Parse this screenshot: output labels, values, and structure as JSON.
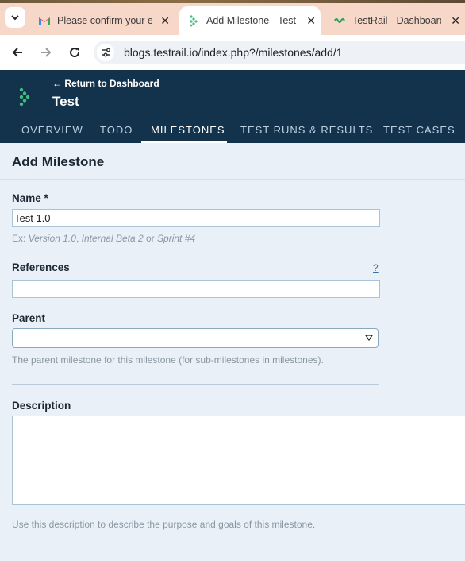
{
  "browser": {
    "tabs": [
      {
        "title": "Please confirm your e",
        "icon": "gmail-icon",
        "active": false
      },
      {
        "title": "Add Milestone - TestR",
        "icon": "testrail-icon",
        "active": true
      },
      {
        "title": "TestRail - Dashboard",
        "icon": "testrail-green-icon",
        "active": false
      }
    ],
    "url": "blogs.testrail.io/index.php?/milestones/add/1",
    "close_glyph": "✕"
  },
  "app": {
    "back_link": "← Return to Dashboard",
    "project_title": "Test",
    "nav_tabs": [
      "OVERVIEW",
      "TODO",
      "MILESTONES",
      "TEST RUNS & RESULTS",
      "TEST CASES"
    ],
    "active_tab": "MILESTONES",
    "brand_color": "#13324c",
    "logo_color": "#3fbf7f"
  },
  "form": {
    "page_title": "Add Milestone",
    "name": {
      "label": "Name *",
      "value": "Test 1.0",
      "hint_prefix": "Ex: ",
      "hint_ex1": "Version 1.0",
      "hint_sep1": ", ",
      "hint_ex2": "Internal Beta 2",
      "hint_sep2": " or ",
      "hint_ex3": "Sprint #4"
    },
    "references": {
      "label": "References",
      "value": "",
      "help": "?"
    },
    "parent": {
      "label": "Parent",
      "selected": "",
      "hint": "The parent milestone for this milestone (for sub-milestones in milestones)."
    },
    "description": {
      "label": "Description",
      "value": "",
      "hint": "Use this description to describe the purpose and goals of this milestone."
    }
  }
}
